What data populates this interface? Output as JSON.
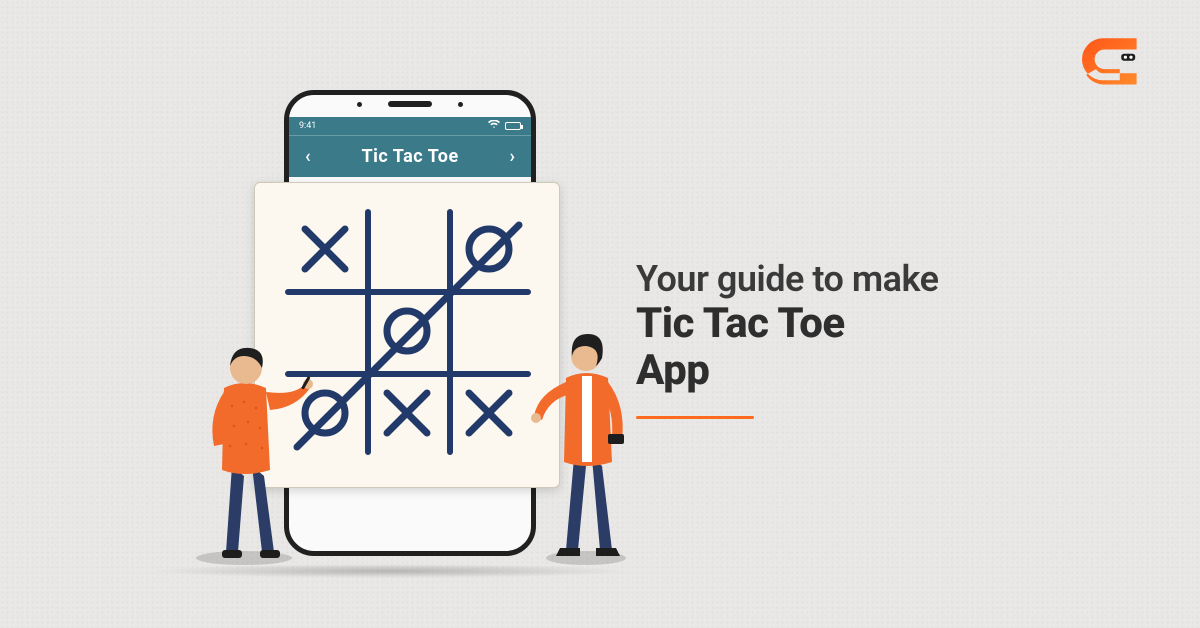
{
  "logo": {
    "name": "coding-ninjas-logo",
    "accent": "#ff6a1f"
  },
  "phone": {
    "status": {
      "time": "9:41",
      "wifi": "wifi-icon",
      "battery_pct": 70
    },
    "app_title": "Tic Tac Toe",
    "nav": {
      "back": "‹",
      "forward": "›"
    }
  },
  "game": {
    "board": [
      [
        "X",
        "",
        "O"
      ],
      [
        "",
        "O",
        ""
      ],
      [
        "O",
        "X",
        "X"
      ]
    ],
    "win_line": "anti-diagonal",
    "mark_color": "#223a6a"
  },
  "heading": {
    "line1": "Your guide to make",
    "line2": "Tic Tac Toe",
    "line3": "App",
    "underline_color": "#ff6a1f"
  },
  "people": {
    "left": {
      "shirt": "#f26b2a",
      "pants": "#2b3d66",
      "hair": "#1f1f1f"
    },
    "right": {
      "jacket": "#f26b2a",
      "pants": "#2b3d66",
      "hair": "#1f1f1f",
      "shirt": "#ffffff"
    }
  }
}
